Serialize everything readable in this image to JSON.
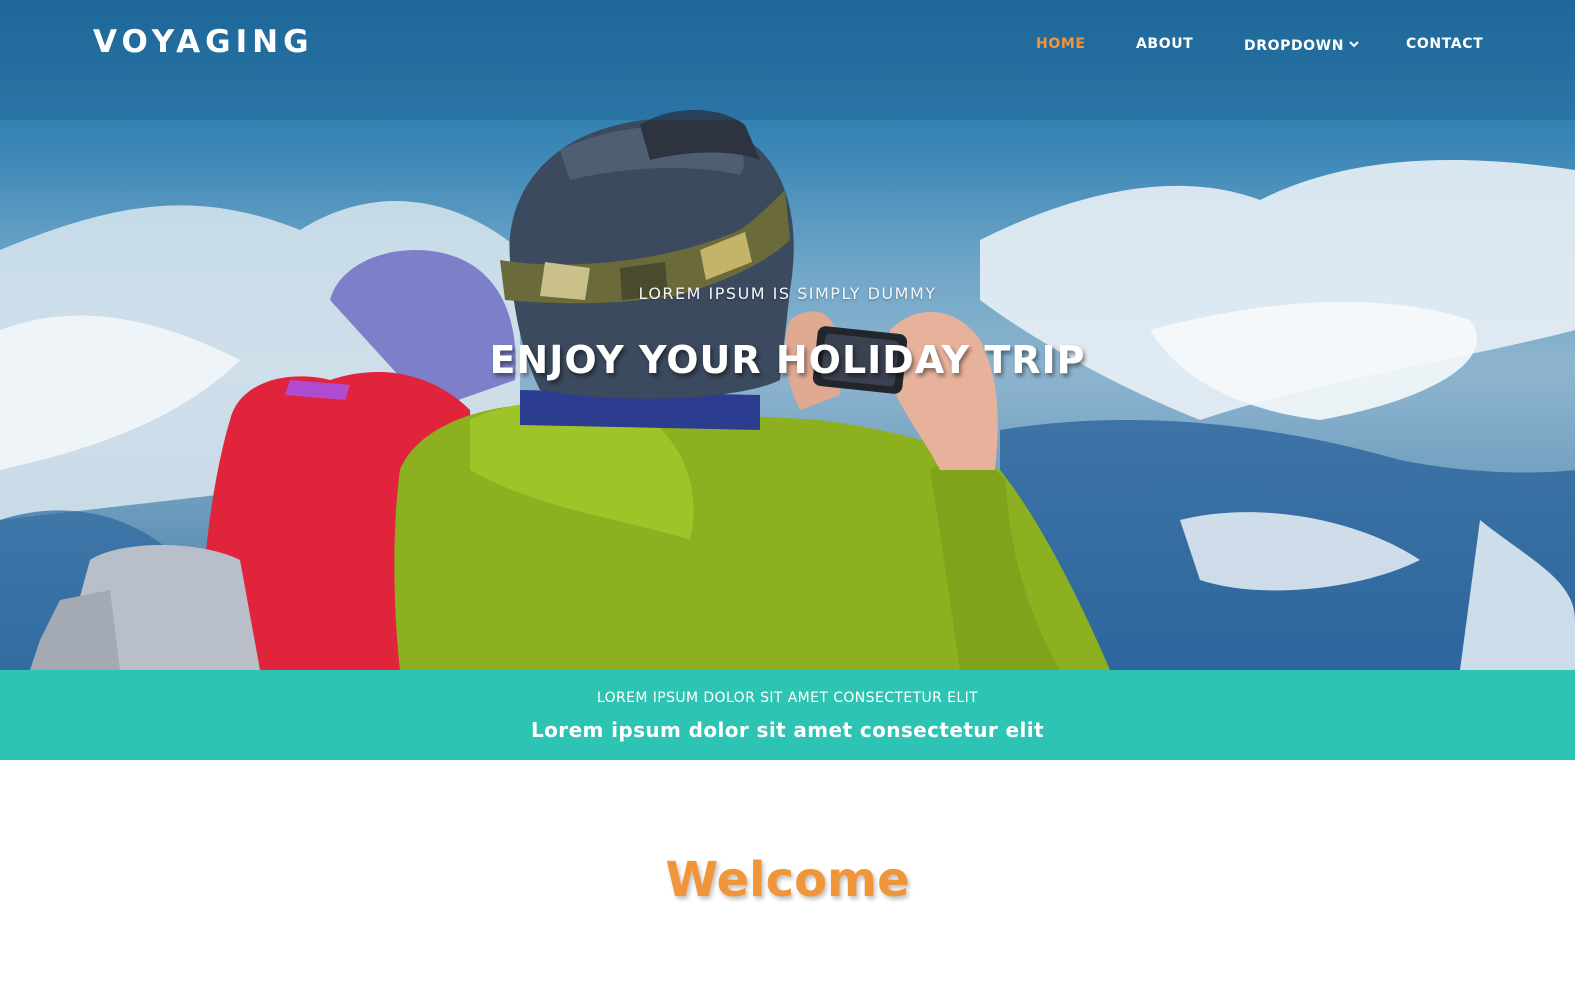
{
  "brand": {
    "name": "VOYAGING"
  },
  "nav": {
    "items": [
      {
        "label": "HOME",
        "active": true
      },
      {
        "label": "ABOUT",
        "active": false
      },
      {
        "label": "DROPDOWN",
        "active": false,
        "icon": "chevron-down-icon"
      },
      {
        "label": "CONTACT",
        "active": false
      }
    ]
  },
  "hero": {
    "subtitle": "LOREM IPSUM IS SIMPLY DUMMY",
    "title": "ENJOY YOUR HOLIDAY TRIP",
    "image": "two skiers in helmets and jackets photographing snowy mountains"
  },
  "banner": {
    "top_text": "LOREM IPSUM DOLOR SIT AMET CONSECTETUR ELIT",
    "bottom_text": "Lorem ipsum dolor sit amet consectetur elit",
    "color": "#2ec4b4"
  },
  "welcome": {
    "title": "Welcome"
  },
  "colors": {
    "accent": "#f0953a",
    "banner": "#2ec4b4",
    "text_light": "#ffffff"
  }
}
